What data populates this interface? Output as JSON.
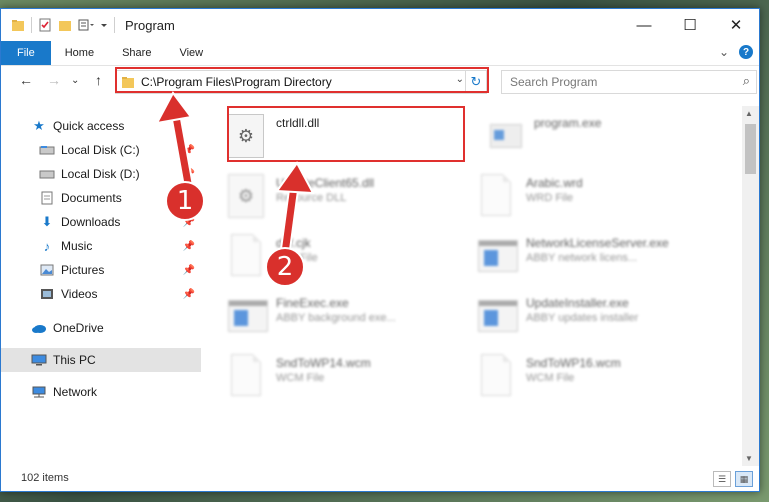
{
  "window": {
    "title": "Program",
    "controls": {
      "minimize": "—",
      "maximize": "☐",
      "close": "✕"
    }
  },
  "ribbon": {
    "tabs": [
      "File",
      "Home",
      "Share",
      "View"
    ],
    "expand": "⌄",
    "help": "?"
  },
  "navigation": {
    "back": "←",
    "forward": "→",
    "recent": "⌄",
    "up": "↑",
    "address": "C:\\Program Files\\Program Directory",
    "address_dropdown": "⌄",
    "refresh": "↻",
    "search_placeholder": "Search Program",
    "search_icon": "⌕"
  },
  "sidebar": {
    "items": [
      {
        "label": "Quick access",
        "icon": "star-icon"
      },
      {
        "label": "Local Disk (C:)",
        "icon": "drive-icon",
        "pinned": true
      },
      {
        "label": "Local Disk (D:)",
        "icon": "drive-icon",
        "pinned": true
      },
      {
        "label": "Documents",
        "icon": "documents-icon",
        "pinned": true
      },
      {
        "label": "Downloads",
        "icon": "download-icon",
        "pinned": true
      },
      {
        "label": "Music",
        "icon": "music-icon",
        "pinned": true
      },
      {
        "label": "Pictures",
        "icon": "pictures-icon",
        "pinned": true
      },
      {
        "label": "Videos",
        "icon": "videos-icon",
        "pinned": true
      },
      {
        "label": "OneDrive",
        "icon": "cloud-icon"
      },
      {
        "label": "This PC",
        "icon": "computer-icon",
        "selected": true
      },
      {
        "label": "Network",
        "icon": "network-icon"
      }
    ]
  },
  "files": [
    {
      "name": "ctrldll.dll",
      "type": "",
      "icon": "dll-gear-icon",
      "highlighted": true
    },
    {
      "name": "program.exe",
      "type": "",
      "icon": "exe-icon"
    },
    {
      "name": "UpdateClient65.dll",
      "type": "Resource DLL",
      "icon": "dll-gear-icon"
    },
    {
      "name": "Arabic.wrd",
      "type": "WRD File",
      "icon": "document-icon"
    },
    {
      "name": "def.cjk",
      "type": "CJK File",
      "icon": "document-icon"
    },
    {
      "name": "NetworkLicenseServer.exe",
      "type": "ABBY network licens...",
      "icon": "app-window-icon"
    },
    {
      "name": "FineExec.exe",
      "type": "ABBY background exe...",
      "icon": "app-window-icon"
    },
    {
      "name": "UpdateInstaller.exe",
      "type": "ABBY updates installer",
      "icon": "app-window-icon"
    },
    {
      "name": "SndToWP14.wcm",
      "type": "WCM File",
      "icon": "document-icon"
    },
    {
      "name": "SndToWP16.wcm",
      "type": "WCM File",
      "icon": "document-icon"
    }
  ],
  "annotations": {
    "step1": "1",
    "step2": "2"
  },
  "status": {
    "item_count": "102 items"
  },
  "colors": {
    "accent": "#1979ca",
    "highlight": "#e0302e"
  }
}
